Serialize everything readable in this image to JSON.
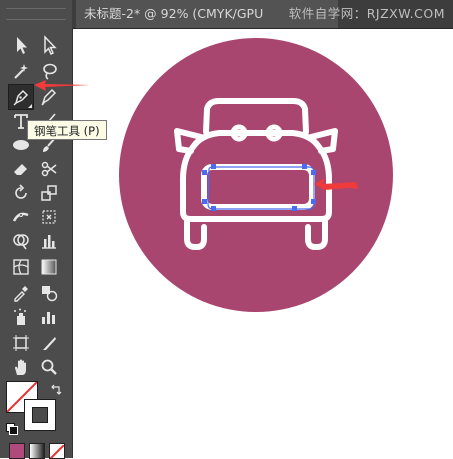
{
  "document_tab": {
    "title": "未标题-2* @ 92% (CMYK/GPU"
  },
  "watermark": {
    "text": "软件自学网：RJZXW.COM"
  },
  "tooltip": {
    "text": "钢笔工具 (P)"
  },
  "toolbar": {
    "tools": [
      {
        "name": "selection-tool-icon"
      },
      {
        "name": "direct-selection-tool-icon"
      },
      {
        "name": "magic-wand-tool-icon"
      },
      {
        "name": "lasso-tool-icon"
      },
      {
        "name": "pen-tool-icon",
        "active": true
      },
      {
        "name": "curvature-tool-icon"
      },
      {
        "name": "type-tool-icon"
      },
      {
        "name": "line-segment-tool-icon"
      },
      {
        "name": "ellipse-tool-icon"
      },
      {
        "name": "paintbrush-tool-icon"
      },
      {
        "name": "eraser-tool-icon"
      },
      {
        "name": "scissors-tool-icon"
      },
      {
        "name": "rotate-tool-icon"
      },
      {
        "name": "scale-tool-icon"
      },
      {
        "name": "width-tool-icon"
      },
      {
        "name": "free-transform-tool-icon"
      },
      {
        "name": "shape-builder-tool-icon"
      },
      {
        "name": "graph-tool-icon"
      },
      {
        "name": "mesh-tool-icon"
      },
      {
        "name": "gradient-tool-icon"
      },
      {
        "name": "eyedropper-tool-icon"
      },
      {
        "name": "blend-tool-icon"
      },
      {
        "name": "symbol-sprayer-tool-icon"
      },
      {
        "name": "column-graph-tool-icon"
      },
      {
        "name": "artboard-tool-icon"
      },
      {
        "name": "slice-tool-icon"
      },
      {
        "name": "hand-tool-icon"
      },
      {
        "name": "zoom-tool-icon"
      }
    ]
  },
  "colors": {
    "circle_fill": "#a8466f",
    "toolbar_bg": "#4c4c4c",
    "anchor_blue": "#4a6cf0",
    "arrow_red": "#ef3b3b",
    "swatch_pink": "#b04a7a"
  }
}
